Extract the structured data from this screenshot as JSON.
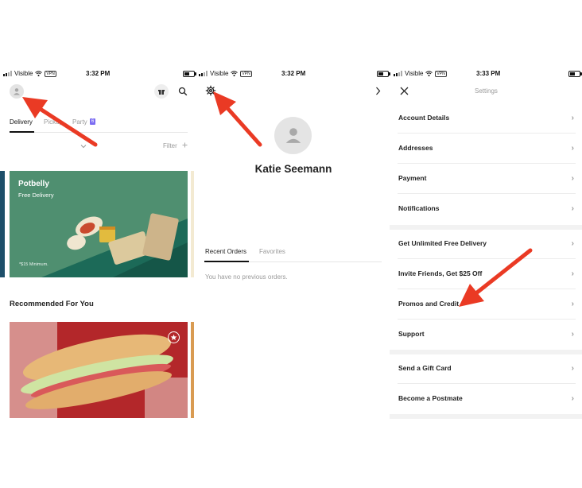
{
  "screens": {
    "home": {
      "status": {
        "carrier": "Visible",
        "vpn": "VPN",
        "time": "3:32 PM"
      },
      "tabs": [
        "Delivery",
        "Pickup",
        "Party"
      ],
      "party_badge": "6",
      "filter_label": "Filter",
      "promo": {
        "title": "Potbelly",
        "subtitle": "Free Delivery",
        "note": "*$15 Minimum."
      },
      "section_title": "Recommended For You"
    },
    "profile": {
      "status": {
        "carrier": "Visible",
        "vpn": "VPN",
        "time": "3:32 PM"
      },
      "name": "Katie Seemann",
      "tabs": [
        "Recent Orders",
        "Favorites"
      ],
      "empty_text": "You have no previous orders."
    },
    "settings": {
      "status": {
        "carrier": "Visible",
        "vpn": "VPN",
        "time": "3:33 PM"
      },
      "title": "Settings",
      "groups": [
        [
          "Account Details",
          "Addresses",
          "Payment",
          "Notifications"
        ],
        [
          "Get Unlimited Free Delivery",
          "Invite Friends, Get $25 Off",
          "Promos and Credit",
          "Support"
        ],
        [
          "Send a Gift Card",
          "Become a Postmate"
        ]
      ]
    }
  },
  "colors": {
    "accent_green": "#4f8f70",
    "arrow_red": "#ea3a24",
    "promo_dark": "#1d4f6a",
    "party_badge": "#7b6cf2"
  },
  "icons": [
    "avatar-icon",
    "gift-icon",
    "search-icon",
    "gear-icon",
    "chevron-right-icon",
    "close-icon",
    "chevron-down-icon",
    "plus-icon",
    "star-icon",
    "wifi-icon",
    "battery-icon"
  ]
}
